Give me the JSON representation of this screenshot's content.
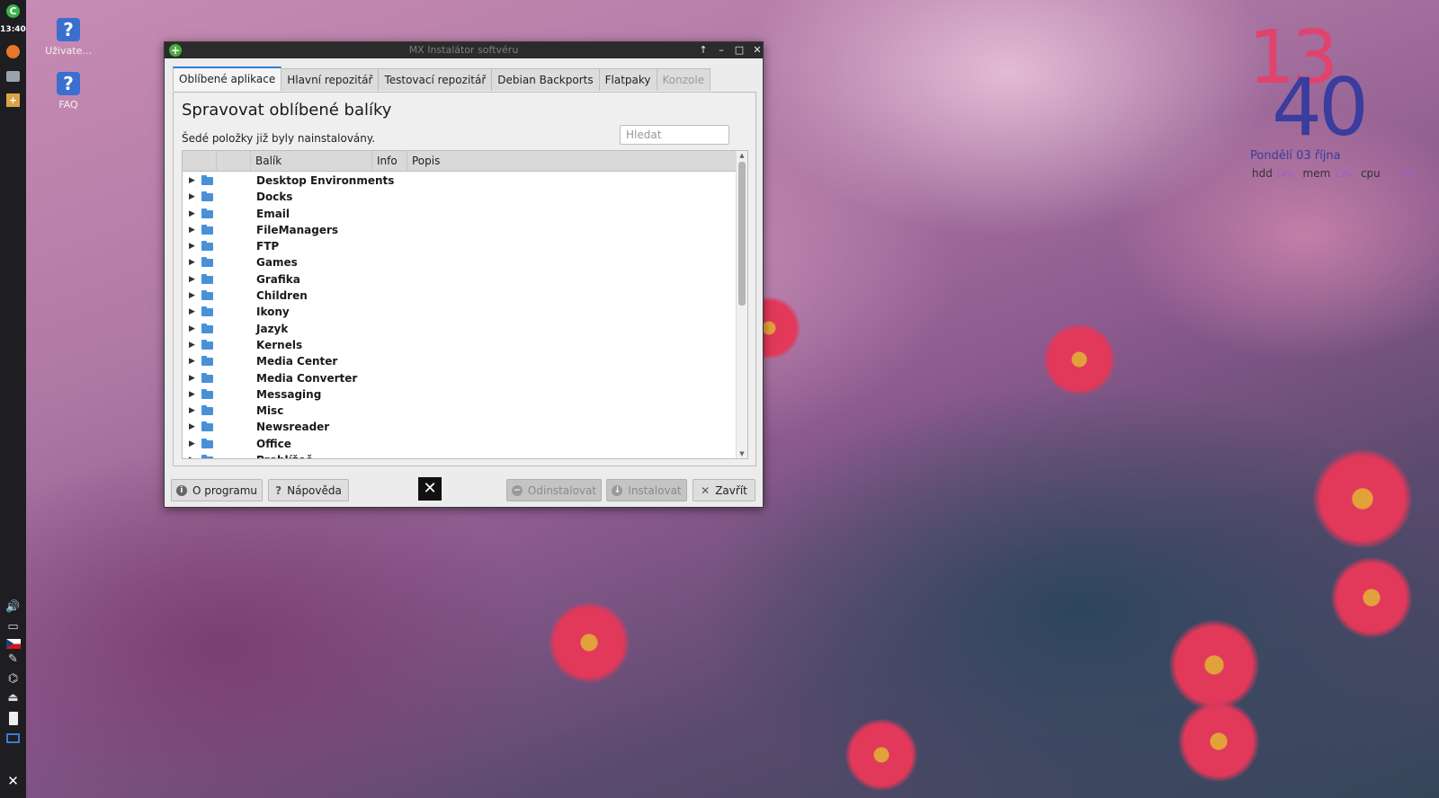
{
  "panel": {
    "clock": "13:40"
  },
  "desktop_icons": [
    {
      "label": "Uživate..."
    },
    {
      "label": "FAQ"
    }
  ],
  "conky": {
    "hours": "13",
    "minutes": "40",
    "date": "Pondělí 03 října",
    "hdd_label": "hdd",
    "hdd_value": "14%",
    "mem_label": "mem",
    "mem_value": "13%",
    "cpu_label": "cpu",
    "cpu_value": "5%"
  },
  "window": {
    "title": "MX Instalátor softvéru",
    "tabs": [
      {
        "label": "Oblíbené aplikace"
      },
      {
        "label": "Hlavní repozitář"
      },
      {
        "label": "Testovací repozitář"
      },
      {
        "label": "Debian Backports"
      },
      {
        "label": "Flatpaky"
      },
      {
        "label": "Konzole"
      }
    ],
    "heading": "Spravovat oblíbené balíky",
    "note": "Šedé položky již byly nainstalovány.",
    "search_placeholder": "Hledat",
    "columns": {
      "package": "Balík",
      "info": "Info",
      "description": "Popis"
    },
    "categories": [
      "Desktop Environments",
      "Docks",
      "Email",
      "FileManagers",
      "FTP",
      "Games",
      "Grafika",
      "Children",
      "Ikony",
      "Jazyk",
      "Kernels",
      "Media Center",
      "Media Converter",
      "Messaging",
      "Misc",
      "Newsreader",
      "Office",
      "Prohlížeč"
    ],
    "buttons": {
      "about": "O programu",
      "help": "Nápověda",
      "uninstall": "Odinstalovat",
      "install": "Instalovat",
      "close": "Zavřít"
    }
  },
  "colors": {
    "accent": "#2d7ed8",
    "conky_hours": "#e0436e",
    "conky_minutes": "#3a3c9e"
  }
}
